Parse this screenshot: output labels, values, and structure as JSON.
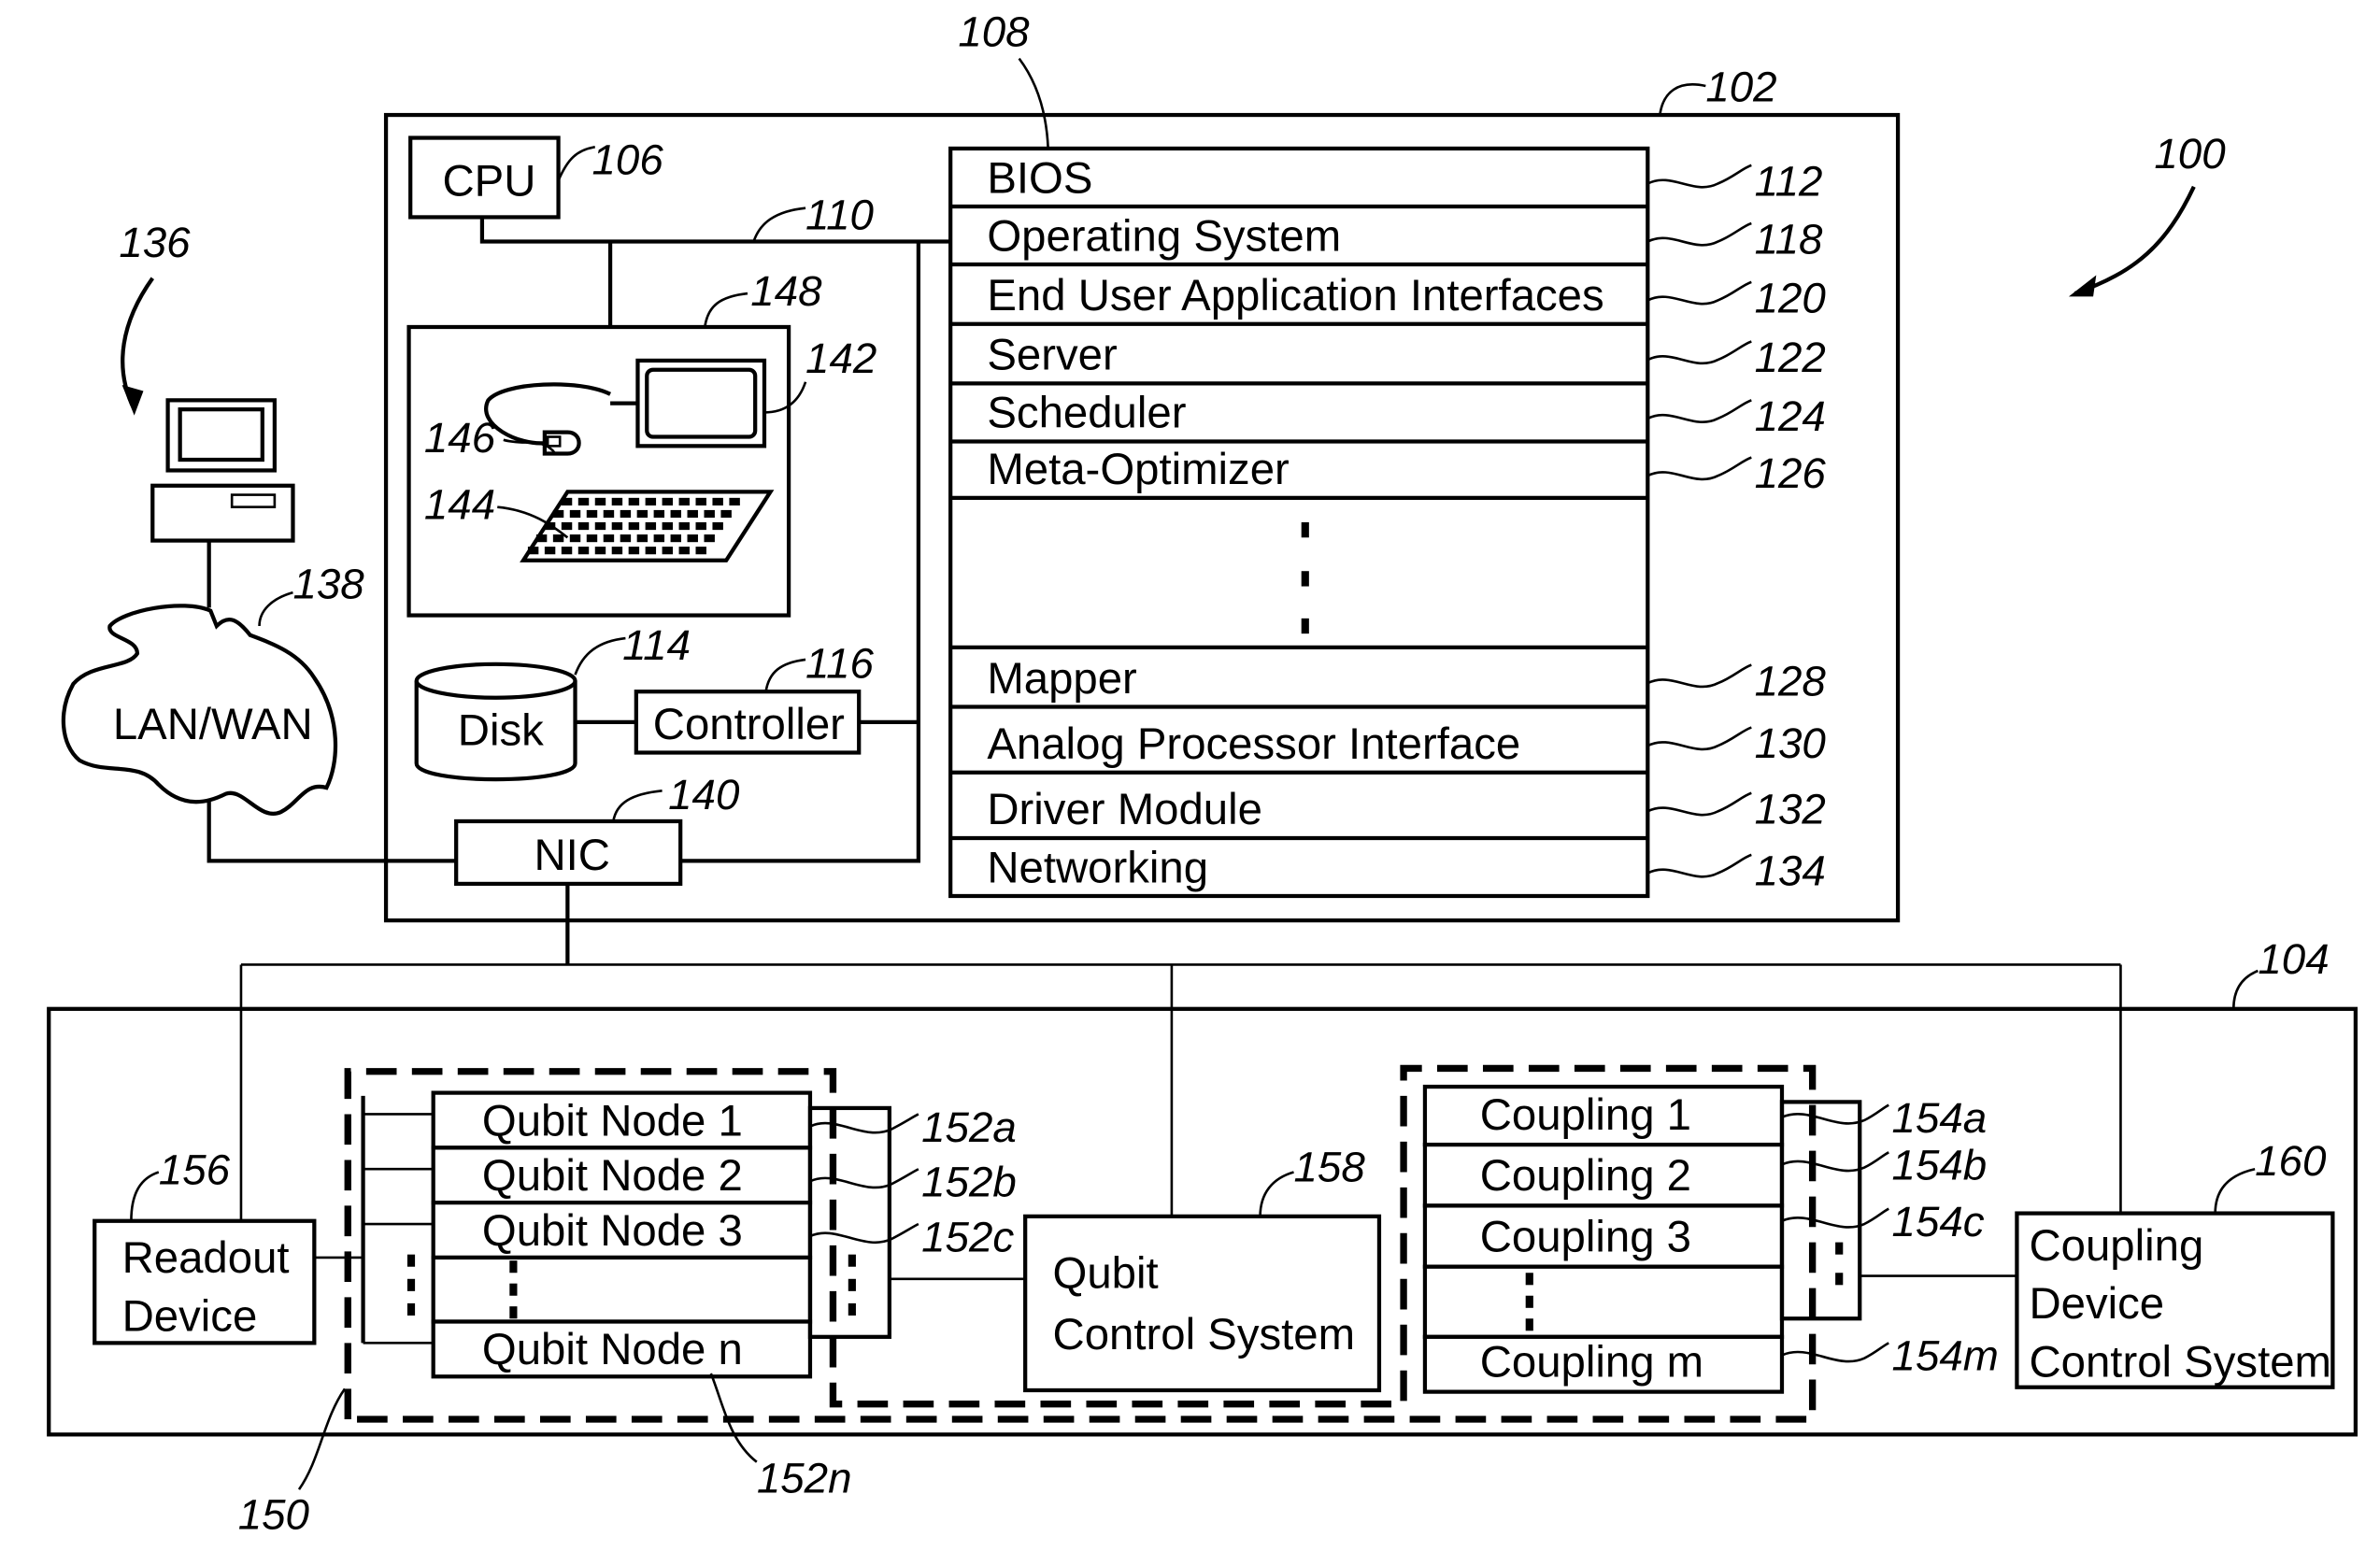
{
  "figure_number": "100",
  "host_computer": {
    "ref": "102",
    "cpu": {
      "label": "CPU",
      "ref": "106"
    },
    "bus_ref": "110",
    "memory_ref": "108",
    "io_terminal": {
      "ref": "148",
      "display_ref": "142",
      "keyboard_ref": "144",
      "mouse_ref": "146"
    },
    "disk": {
      "label": "Disk",
      "ref": "114"
    },
    "controller": {
      "label": "Controller",
      "ref": "116"
    },
    "nic": {
      "label": "NIC",
      "ref": "140"
    },
    "memory_modules": [
      {
        "label": "BIOS",
        "ref": "112"
      },
      {
        "label": "Operating  System",
        "ref": "118"
      },
      {
        "label": "End  User  Application  Interfaces",
        "ref": "120"
      },
      {
        "label": "Server",
        "ref": "122"
      },
      {
        "label": "Scheduler",
        "ref": "124"
      },
      {
        "label": "Meta-Optimizer",
        "ref": "126"
      },
      {
        "label": "",
        "ref": ""
      },
      {
        "label": "Mapper",
        "ref": "128"
      },
      {
        "label": "Analog  Processor  Interface",
        "ref": "130"
      },
      {
        "label": "Driver  Module",
        "ref": "132"
      },
      {
        "label": "Networking",
        "ref": "134"
      }
    ]
  },
  "remote": {
    "terminal_ref": "136",
    "network": {
      "label": "LAN/WAN",
      "ref": "138"
    }
  },
  "analog_processor": {
    "ref": "104",
    "qubit_array_ref": "150",
    "readout": {
      "line1": "Readout",
      "line2": "Device",
      "ref": "156"
    },
    "qubit_nodes": [
      {
        "label": "Qubit  Node  1",
        "ref": "152a"
      },
      {
        "label": "Qubit  Node  2",
        "ref": "152b"
      },
      {
        "label": "Qubit  Node  3",
        "ref": "152c"
      },
      {
        "label": "",
        "ref": ""
      },
      {
        "label": "Qubit  Node  n",
        "ref": "152n"
      }
    ],
    "qubit_control": {
      "line1": "Qubit",
      "line2": "Control  System",
      "ref": "158"
    },
    "couplings": [
      {
        "label": "Coupling  1",
        "ref": "154a"
      },
      {
        "label": "Coupling  2",
        "ref": "154b"
      },
      {
        "label": "Coupling  3",
        "ref": "154c"
      },
      {
        "label": "",
        "ref": ""
      },
      {
        "label": "Coupling  m",
        "ref": "154m"
      }
    ],
    "coupling_control": {
      "line1": "Coupling",
      "line2": "Device",
      "line3": "Control  System",
      "ref": "160"
    }
  }
}
